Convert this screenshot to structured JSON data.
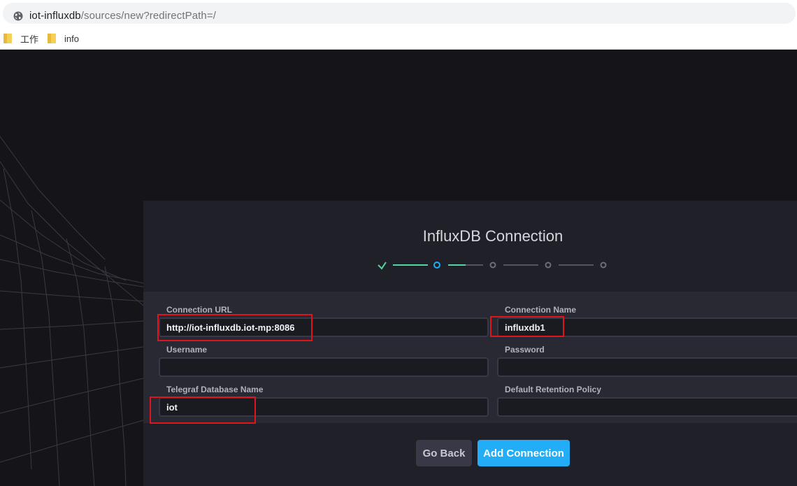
{
  "browser": {
    "url_host": "iot-influxdb",
    "url_path": "/sources/new?redirectPath=/",
    "bookmarks": [
      {
        "label": "工作"
      },
      {
        "label": "info"
      }
    ]
  },
  "panel": {
    "title": "InfluxDB Connection",
    "steps": [
      "complete",
      "current",
      "pending",
      "pending",
      "pending"
    ]
  },
  "form": {
    "connection_url": {
      "label": "Connection URL",
      "value": "http://iot-influxdb.iot-mp:8086"
    },
    "connection_name": {
      "label": "Connection Name",
      "value": "influxdb1"
    },
    "username": {
      "label": "Username",
      "value": ""
    },
    "password": {
      "label": "Password",
      "value": ""
    },
    "telegraf_db": {
      "label": "Telegraf Database Name",
      "value": "iot"
    },
    "retention_policy": {
      "label": "Default Retention Policy",
      "value": ""
    }
  },
  "buttons": {
    "go_back": "Go Back",
    "add_connection": "Add Connection"
  },
  "colors": {
    "accent": "#22adf6",
    "success": "#4ed8a0",
    "highlight": "#e0141d",
    "background": "#141419"
  }
}
